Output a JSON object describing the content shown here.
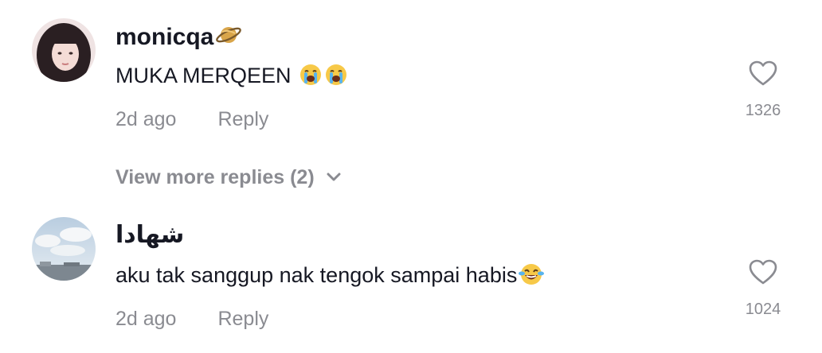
{
  "comments": [
    {
      "username": "monicqa",
      "badge_icon": "ringed-planet-icon",
      "text": "MUKA MERQEEN",
      "emojis": [
        "loudly-crying-face-icon",
        "loudly-crying-face-icon"
      ],
      "time": "2d ago",
      "reply_label": "Reply",
      "like_count": "1326"
    },
    {
      "username": "شهادا",
      "text": "aku tak sanggup nak tengok sampai habis",
      "emojis": [
        "face-with-tears-of-joy-icon"
      ],
      "time": "2d ago",
      "reply_label": "Reply",
      "like_count": "1024"
    }
  ],
  "view_more": {
    "label": "View more replies (2)",
    "icon": "chevron-down-icon"
  },
  "colors": {
    "text": "#161823",
    "muted": "#8a8b91",
    "background": "#ffffff"
  }
}
